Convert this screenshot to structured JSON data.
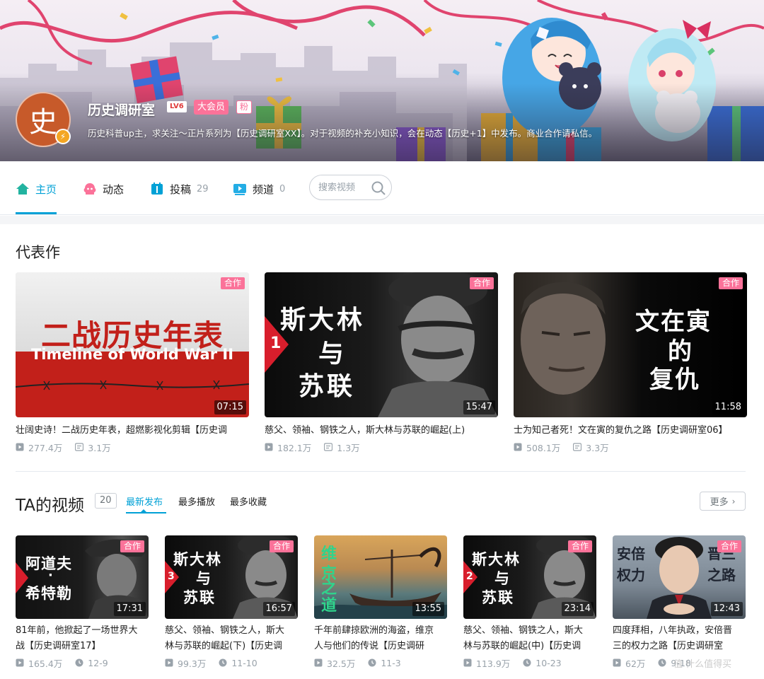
{
  "profile": {
    "name": "历史调研室",
    "level": "LV6",
    "vip": "大会员",
    "fan_tag": "粉",
    "avatar_char": "史",
    "sign": "历史科普up主，求关注～正片系列为【历史调研室XX】。对于视频的补充小知识，会在动态【历史+1】中发布。商业合作请私信。"
  },
  "nav": {
    "home": "主页",
    "dynamic": "动态",
    "posts": "投稿",
    "posts_count": "29",
    "channel": "频道",
    "channel_count": "0",
    "search_placeholder": "搜索视频"
  },
  "masterpieces": {
    "title": "代表作",
    "items": [
      {
        "title": "壮阔史诗！二战历史年表，超燃影视化剪辑【历史调",
        "thumb_line1": "二战历史年表",
        "thumb_line2": "Timeline of World War II",
        "duration": "07:15",
        "tag": "合作",
        "plays": "277.4万",
        "danmaku": "3.1万"
      },
      {
        "title": "慈父、领袖、钢铁之人，斯大林与苏联的崛起(上)",
        "thumb_line1": "斯大林",
        "thumb_line2": "与",
        "thumb_line3": "苏联",
        "thumb_num": "1",
        "duration": "15:47",
        "tag": "合作",
        "plays": "182.1万",
        "danmaku": "1.3万"
      },
      {
        "title": "士为知己者死！文在寅的复仇之路【历史调研室06】",
        "thumb_line1": "文在寅",
        "thumb_line2": "的",
        "thumb_line3": "复仇",
        "duration": "11:58",
        "tag": "合作",
        "plays": "508.1万",
        "danmaku": "3.3万"
      }
    ]
  },
  "videos": {
    "title": "TA的视频",
    "count": "20",
    "sort_tabs": [
      "最新发布",
      "最多播放",
      "最多收藏"
    ],
    "more": "更多",
    "items": [
      {
        "title_l1": "81年前，他掀起了一场世界大",
        "title_l2": "战【历史调研室17】",
        "thumb_line1": "阿道夫",
        "thumb_line2": "·",
        "thumb_line3": "希特勒",
        "duration": "17:31",
        "tag": "合作",
        "plays": "165.4万",
        "date": "12-9"
      },
      {
        "title_l1": "慈父、领袖、钢铁之人，斯大",
        "title_l2": "林与苏联的崛起(下)【历史调",
        "thumb_line1": "斯大林",
        "thumb_line2": "与",
        "thumb_line3": "苏联",
        "thumb_num": "3",
        "duration": "16:57",
        "tag": "合作",
        "plays": "99.3万",
        "date": "11-10"
      },
      {
        "title_l1": "千年前肆掠欧洲的海盗，维京",
        "title_l2": "人与他们的传说【历史调研",
        "thumb_line1": "维",
        "thumb_line2": "京",
        "thumb_line3": "之道",
        "duration": "13:55",
        "tag": "",
        "plays": "32.5万",
        "date": "11-3"
      },
      {
        "title_l1": "慈父、领袖、钢铁之人，斯大",
        "title_l2": "林与苏联的崛起(中)【历史调",
        "thumb_line1": "斯大林",
        "thumb_line2": "与",
        "thumb_line3": "苏联",
        "thumb_num": "2",
        "duration": "23:14",
        "tag": "合作",
        "plays": "113.9万",
        "date": "10-23"
      },
      {
        "title_l1": "四度拜相，八年执政，安倍晋",
        "title_l2": "三的权力之路【历史调研室",
        "thumb_line1": "安倍",
        "thumb_line2": "晋三",
        "thumb_line3": "权力",
        "thumb_line4": "之路",
        "duration": "12:43",
        "tag": "合作",
        "plays": "62万",
        "date": "9-18"
      }
    ]
  },
  "watermark": "值 什么值得买",
  "colors": {
    "accent": "#00a1d6",
    "pink": "#fb7299",
    "muted": "#99a2aa",
    "red_thumb": "#c2201a"
  }
}
